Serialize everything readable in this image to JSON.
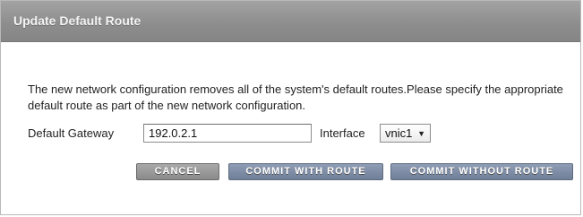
{
  "dialog": {
    "title": "Update Default Route",
    "message": "The new network configuration removes all of the system's default routes.Please specify the appropriate default route as part of the new network configuration."
  },
  "form": {
    "gateway_label": "Default Gateway",
    "gateway_value": "192.0.2.1",
    "interface_label": "Interface",
    "interface_selected": "vnic1",
    "dropdown_icon": "triangle-down-icon"
  },
  "buttons": {
    "cancel": "CANCEL",
    "commit_with_route": "COMMIT WITH ROUTE",
    "commit_without_route": "COMMIT WITHOUT ROUTE"
  }
}
